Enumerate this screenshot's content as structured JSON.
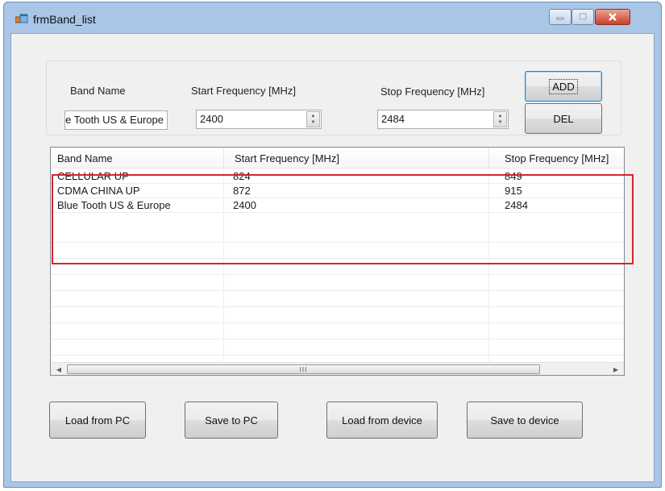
{
  "window": {
    "title": "frmBand_list",
    "controls": {
      "minimize": "–",
      "maximize": "□",
      "close": "✕"
    }
  },
  "form": {
    "band_name_label": "Band Name",
    "start_freq_label": "Start Frequency [MHz]",
    "stop_freq_label": "Stop Frequency [MHz]",
    "band_name_value": "Blue Tooth US & Europe",
    "start_freq_value": "2400",
    "stop_freq_value": "2484",
    "add_label": "ADD",
    "del_label": "DEL"
  },
  "grid": {
    "columns": [
      "Band Name",
      "Start Frequency [MHz]",
      "Stop Frequency [MHz]"
    ],
    "rows": [
      [
        "CELLULAR UP",
        "824",
        "849"
      ],
      [
        "CDMA CHINA UP",
        "872",
        "915"
      ],
      [
        "Blue Tooth US & Europe",
        "2400",
        "2484"
      ]
    ],
    "scroll_thumb_grip": "III",
    "scroll_left": "◀",
    "scroll_right": "▶"
  },
  "actions": {
    "load_pc": "Load from PC",
    "save_pc": "Save to PC",
    "load_device": "Load from device",
    "save_device": "Save to device"
  },
  "colors": {
    "highlight": "#d8252c",
    "titlebar": "#a9c6e6"
  }
}
